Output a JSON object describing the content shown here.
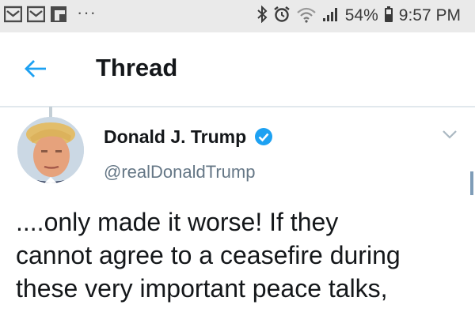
{
  "status_bar": {
    "more": "···",
    "battery": "54%",
    "time": "9:57 PM"
  },
  "header": {
    "title": "Thread"
  },
  "tweet": {
    "author_name": "Donald J. Trump",
    "author_handle": "@realDonaldTrump",
    "verified": true,
    "text_lines": [
      "....only made it worse! If they",
      "cannot agree to a ceasefire during",
      "these very important peace talks,"
    ]
  },
  "colors": {
    "accent": "#1da1f2",
    "status_bar_bg": "#eaeaea",
    "text": "#14171a",
    "secondary_text": "#657786"
  }
}
